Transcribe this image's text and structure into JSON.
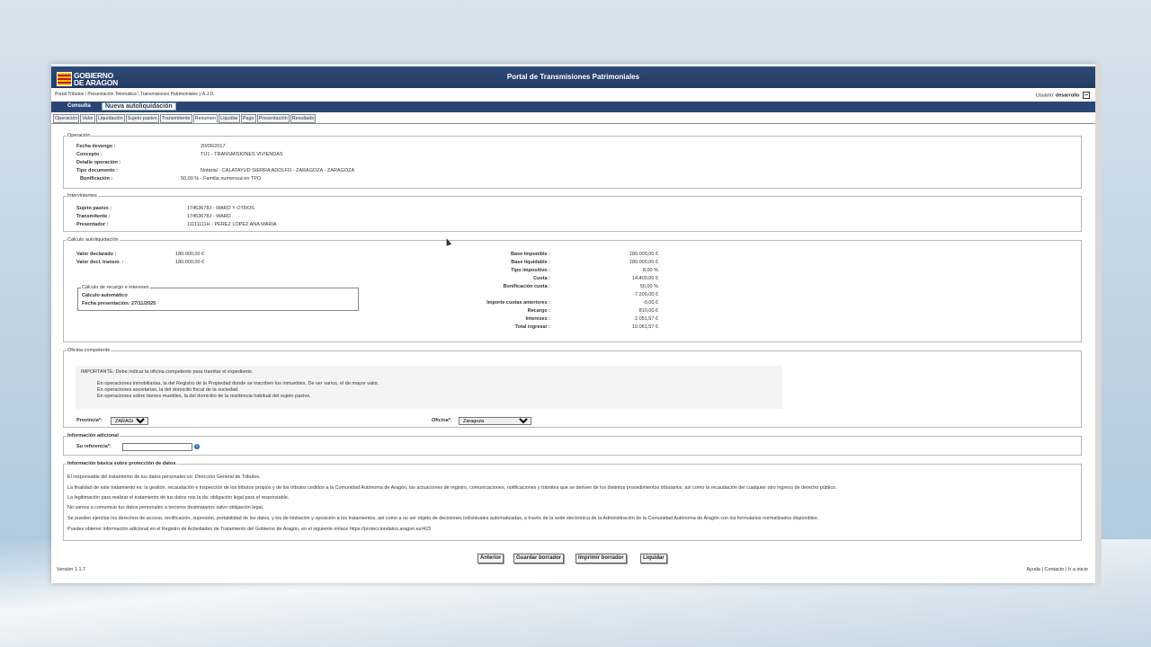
{
  "header": {
    "logo_line1": "GOBIERNO",
    "logo_line2": "DE ARAGON",
    "title": "Portal de Transmisiones Patrimoniales",
    "breadcrumb": "Portal Tributos \\ Presentación Telemática \\ Transmisiones Patrimoniales y A.J.D.",
    "user_label": "Usuario:",
    "user_name": "desarrollo"
  },
  "nav": {
    "consulta": "Consulta",
    "nueva": "Nueva autoliquidación"
  },
  "tabs": [
    "Operación",
    "Valor",
    "Liquidación",
    "Sujeto pasivo",
    "Transmitente",
    "Resumen",
    "Liquidar",
    "Pago",
    "Presentación",
    "Resultado"
  ],
  "active_tab": "Resumen",
  "operacion": {
    "legend": "Operación",
    "fecha_label": "Fecha devengo :",
    "fecha_value": "20/06/2017",
    "concepto_label": "Concepto :",
    "concepto_value": "TU1  -  TRANSMISIONES VIVIENDAS",
    "detalle_label": "Detalle operación :",
    "tipo_label": "Tipo documento :",
    "tipo_value": "Notarial  -  CALATAYUD SIERRA ADOLFO  -  ZARAGOZA  -  ZARAGOZA",
    "bonif_label": "Bonificación :",
    "bonif_value": "50,00 % - Familia numerosa en TPO"
  },
  "intervinientes": {
    "legend": "Intervinientes",
    "sujeto_label": "Sujeto pasivo :",
    "sujeto_value": "17453678J - WARD  Y OTROS",
    "transm_label": "Transmitente :",
    "transm_value": "17453678J - WARD",
    "pres_label": "Presentador :",
    "pres_value": "11111111H - PEREZ LOPEZ ANA MARIA"
  },
  "calculo": {
    "legend": "Cálculo autoliquidación",
    "valor_decl_label": "Valor declarado :",
    "valor_decl_value": "180.000,00 €",
    "valor_transm_label": "Valor decl. transm. :",
    "valor_transm_value": "180.000,00 €",
    "recargo_legend": "Cálculo de recargo e intereses",
    "recargo_line1": "Cálculo automático",
    "recargo_line2": "Fecha presentación: 27/11/2025",
    "rows": [
      {
        "label": "Base imponible :",
        "value": "180.000,00 €"
      },
      {
        "label": "Base liquidable :",
        "value": "180.000,00 €"
      },
      {
        "label": "Tipo impositivo :",
        "value": "8,00 %"
      },
      {
        "label": "Cuota :",
        "value": "14.400,00 €"
      },
      {
        "label": "Bonificación cuota :",
        "value": "50,00 %"
      },
      {
        "label": "",
        "value": "-7.200,00 €"
      },
      {
        "label": "Importe cuotas anteriores :",
        "value": "-0,00 €"
      },
      {
        "label": "Recargo :",
        "value": "810,00 €"
      },
      {
        "label": "Intereses :",
        "value": "2.051,57 €"
      },
      {
        "label": "Total ingresar :",
        "value": "10.061,57 €"
      }
    ]
  },
  "oficina": {
    "legend": "Oficina competente",
    "important": "IMPORTANTE: Debe indicar la oficina competente para tramitar el expediente.",
    "line1": "En operaciones inmobiliarias, la del Registro de la Propiedad donde se inscriben los inmuebles. De ser varios, el de mayor valor.",
    "line2": "En operaciones societarias, la del domicilio fiscal de la sociedad.",
    "line3": "En operaciones sobre bienes muebles, la del domicilio de la residencia habitual del sujeto pasivo.",
    "provincia_label": "Provincia*:",
    "provincia_value": "ZARAGOZA",
    "oficina_label": "Oficina*:",
    "oficina_value": "Zaragoza"
  },
  "info_adicional": {
    "legend": "Información adicional",
    "ref_label": "Su referencia*:",
    "ref_value": ""
  },
  "proteccion": {
    "legend": "Información básica sobre protección de datos.",
    "p1": "El responsable del tratamiento de tus datos personales es: Dirección General de Tributos.",
    "p2": "La finalidad de este tratamiento es: la gestión, recaudación e inspección de los tributos propios y de los tributos cedidos a la Comunidad Autónoma de Aragón, las actuaciones de registro, comunicaciones, notificaciones y trámites que se deriven de los distintos procedimientos tributarios, así como la recaudación del cualquier otro ingreso de derecho público.",
    "p3": "La legitimación para realizar el tratamiento de tus datos nos la da: obligación legal para el responsable.",
    "p4": "No vamos a comunicar tus datos personales a terceros destinatarios salvo obligación legal.",
    "p5": "Se pueden ejercitar los derechos de acceso, rectificación, supresión, portabilidad de los datos, y los de limitación y oposición a los tratamientos, así como a no ser objeto de decisiones individuales automatizadas, a través de la sede electrónica de la Administración de la Comunidad Autónoma de Aragón con los formularios normalizados disponibles.",
    "p6": "Puedes obtener información adicional en el Registro de Actividades de Tratamiento del Gobierno de Aragón, en el siguiente enlace https://protecciondatos.aragon.es/423"
  },
  "buttons": {
    "anterior": "Anterior",
    "guardar": "Guardar borrador",
    "imprimir": "Imprimir borrador",
    "liquidar": "Liquidar"
  },
  "footer": {
    "version": "Versión 1.1.7",
    "ayuda": "Ayuda",
    "contacto": "Contacto",
    "inicio": "Ir a inicio",
    "sep": "|"
  }
}
